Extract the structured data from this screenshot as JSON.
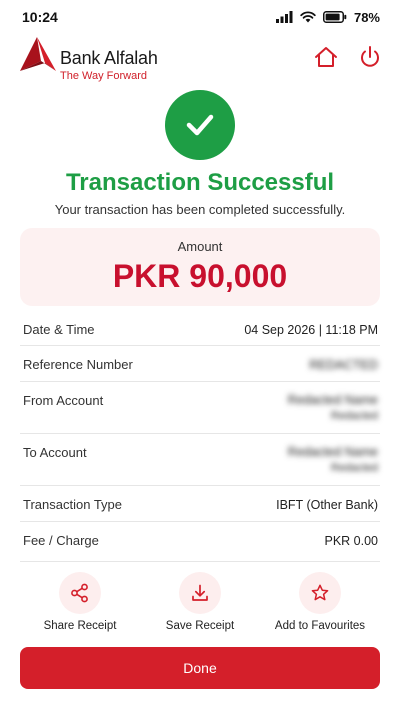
{
  "status_bar": {
    "time": "10:24",
    "battery": "78%"
  },
  "header": {
    "brand": "Bank Alfalah",
    "tagline": "The Way Forward",
    "home_icon": "home-icon",
    "power_icon": "power-icon"
  },
  "result": {
    "icon": "check-icon",
    "title": "Transaction Successful",
    "subtitle": "Your transaction has been completed successfully."
  },
  "amount": {
    "label": "Amount",
    "value": "PKR 90,000"
  },
  "details": [
    {
      "label": "Date & Time",
      "value": "04 Sep 2026 | 11:18 PM",
      "value2": ""
    },
    {
      "label": "Reference Number",
      "value": "REDACTED",
      "value2": ""
    },
    {
      "label": "From Account",
      "value": "Redacted Name",
      "value2": "Redacted"
    },
    {
      "label": "To Account",
      "value": "Redacted Name",
      "value2": "Redacted"
    },
    {
      "label": "Transaction Type",
      "value": "IBFT (Other Bank)",
      "value2": ""
    },
    {
      "label": "Fee / Charge",
      "value": "PKR 0.00",
      "value2": ""
    }
  ],
  "actions": [
    {
      "label": "Share Receipt",
      "icon": "share-icon"
    },
    {
      "label": "Save Receipt",
      "icon": "download-icon"
    },
    {
      "label": "Add to Favourites",
      "icon": "star-icon"
    }
  ],
  "done_label": "Done",
  "colors": {
    "brand_red": "#d41f2a",
    "success_green": "#1e9e45",
    "amount_card_bg": "#fdf1f1"
  }
}
